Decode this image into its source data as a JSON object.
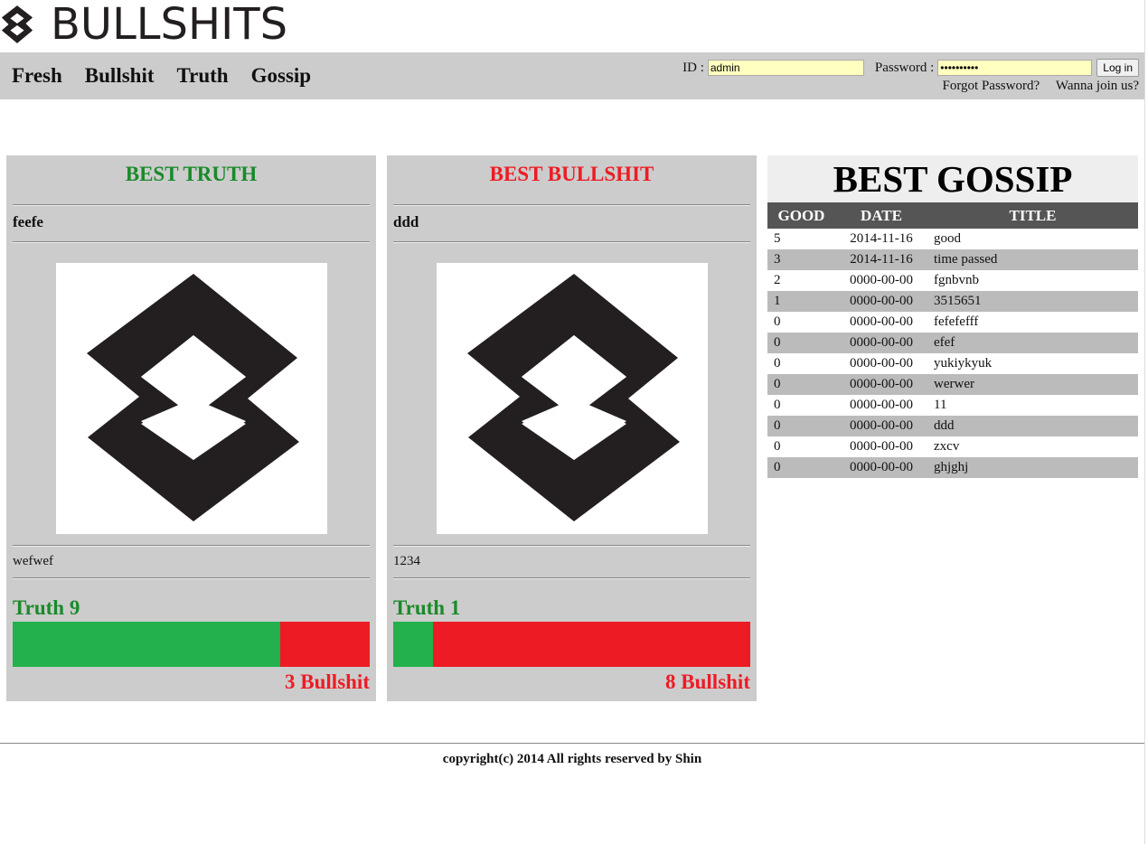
{
  "brand": {
    "name": "BULLSHITS",
    "logo_icon": "diamond-logo-icon"
  },
  "nav": {
    "items": [
      "Fresh",
      "Bullshit",
      "Truth",
      "Gossip"
    ]
  },
  "login": {
    "id_label": "ID :",
    "id_value": "admin",
    "password_label": "Password :",
    "password_value": "••••••••••",
    "login_button": "Log in",
    "forgot_link": "Forgot Password?",
    "join_link": "Wanna join us?"
  },
  "colors": {
    "truth": "#22b14c",
    "bullshit": "#ed1c24",
    "truth_text": "#1a8a2a"
  },
  "best_truth": {
    "heading": "BEST TRUTH",
    "title": "feefe",
    "description": "wefwef",
    "truth_label": "Truth 9",
    "bullshit_label": "3 Bullshit",
    "truth_votes": 9,
    "bullshit_votes": 3
  },
  "best_bullshit": {
    "heading": "BEST BULLSHIT",
    "title": "ddd",
    "description": "1234",
    "truth_label": "Truth 1",
    "bullshit_label": "8 Bullshit",
    "truth_votes": 1,
    "bullshit_votes": 8
  },
  "gossip": {
    "heading": "BEST GOSSIP",
    "columns": [
      "GOOD",
      "DATE",
      "TITLE"
    ],
    "rows": [
      {
        "good": "5",
        "date": "2014-11-16",
        "title": "good"
      },
      {
        "good": "3",
        "date": "2014-11-16",
        "title": "time passed"
      },
      {
        "good": "2",
        "date": "0000-00-00",
        "title": "fgnbvnb"
      },
      {
        "good": "1",
        "date": "0000-00-00",
        "title": "3515651"
      },
      {
        "good": "0",
        "date": "0000-00-00",
        "title": "fefefefff"
      },
      {
        "good": "0",
        "date": "0000-00-00",
        "title": "efef"
      },
      {
        "good": "0",
        "date": "0000-00-00",
        "title": "yukiykyuk"
      },
      {
        "good": "0",
        "date": "0000-00-00",
        "title": "werwer"
      },
      {
        "good": "0",
        "date": "0000-00-00",
        "title": "11"
      },
      {
        "good": "0",
        "date": "0000-00-00",
        "title": "ddd"
      },
      {
        "good": "0",
        "date": "0000-00-00",
        "title": "zxcv"
      },
      {
        "good": "0",
        "date": "0000-00-00",
        "title": "ghjghj"
      }
    ]
  },
  "footer": {
    "text": "copyright(c) 2014 All rights reserved by Shin"
  }
}
